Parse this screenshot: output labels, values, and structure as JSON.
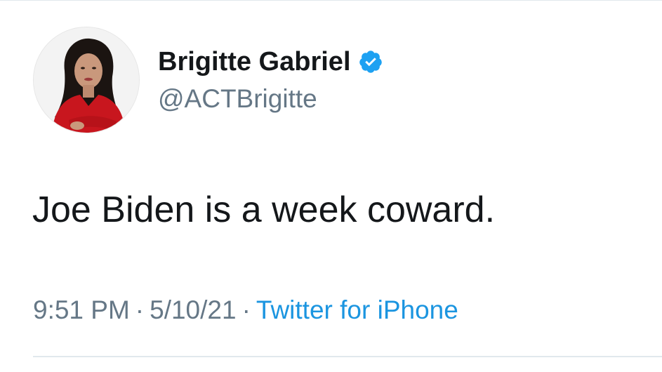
{
  "tweet": {
    "author": {
      "display_name": "Brigitte Gabriel",
      "handle": "@ACTBrigitte",
      "verified": true,
      "verified_icon": "verified-badge-icon",
      "verified_color": "#1da1f2"
    },
    "text": "Joe Biden is a week coward.",
    "time": "9:51 PM",
    "date": "5/10/21",
    "separator": "·",
    "source": "Twitter for iPhone"
  },
  "colors": {
    "text_primary": "#14171a",
    "text_secondary": "#657786",
    "link": "#1b95e0",
    "divider": "#e1e8ed"
  }
}
